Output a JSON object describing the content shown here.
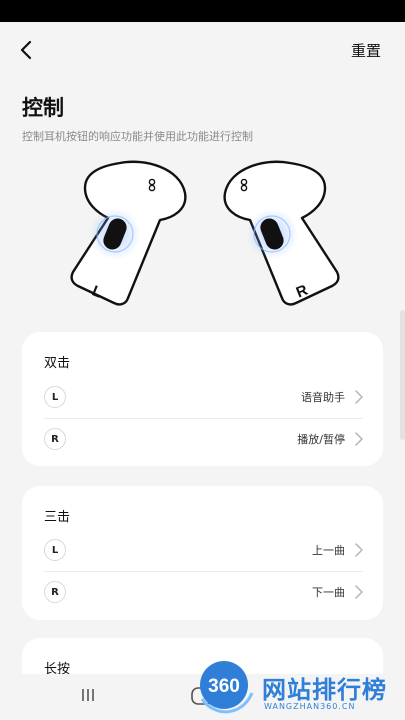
{
  "header": {
    "reset_label": "重置"
  },
  "page": {
    "title": "控制",
    "subtitle": "控制耳机按钮的响应功能并使用此功能进行控制"
  },
  "earbuds": {
    "left_label": "L",
    "right_label": "R"
  },
  "sections": [
    {
      "title": "双击",
      "rows": [
        {
          "side": "L",
          "value": "语音助手"
        },
        {
          "side": "R",
          "value": "播放/暂停"
        }
      ]
    },
    {
      "title": "三击",
      "rows": [
        {
          "side": "L",
          "value": "上一曲"
        },
        {
          "side": "R",
          "value": "下一曲"
        }
      ]
    },
    {
      "title": "长按"
    }
  ],
  "watermark": {
    "badge": "360",
    "text": "网站排行榜",
    "sub": "WANGZHAN360.CN"
  },
  "colors": {
    "accent": "#2f7fd8",
    "background": "#f4f4f4",
    "card": "#ffffff"
  }
}
